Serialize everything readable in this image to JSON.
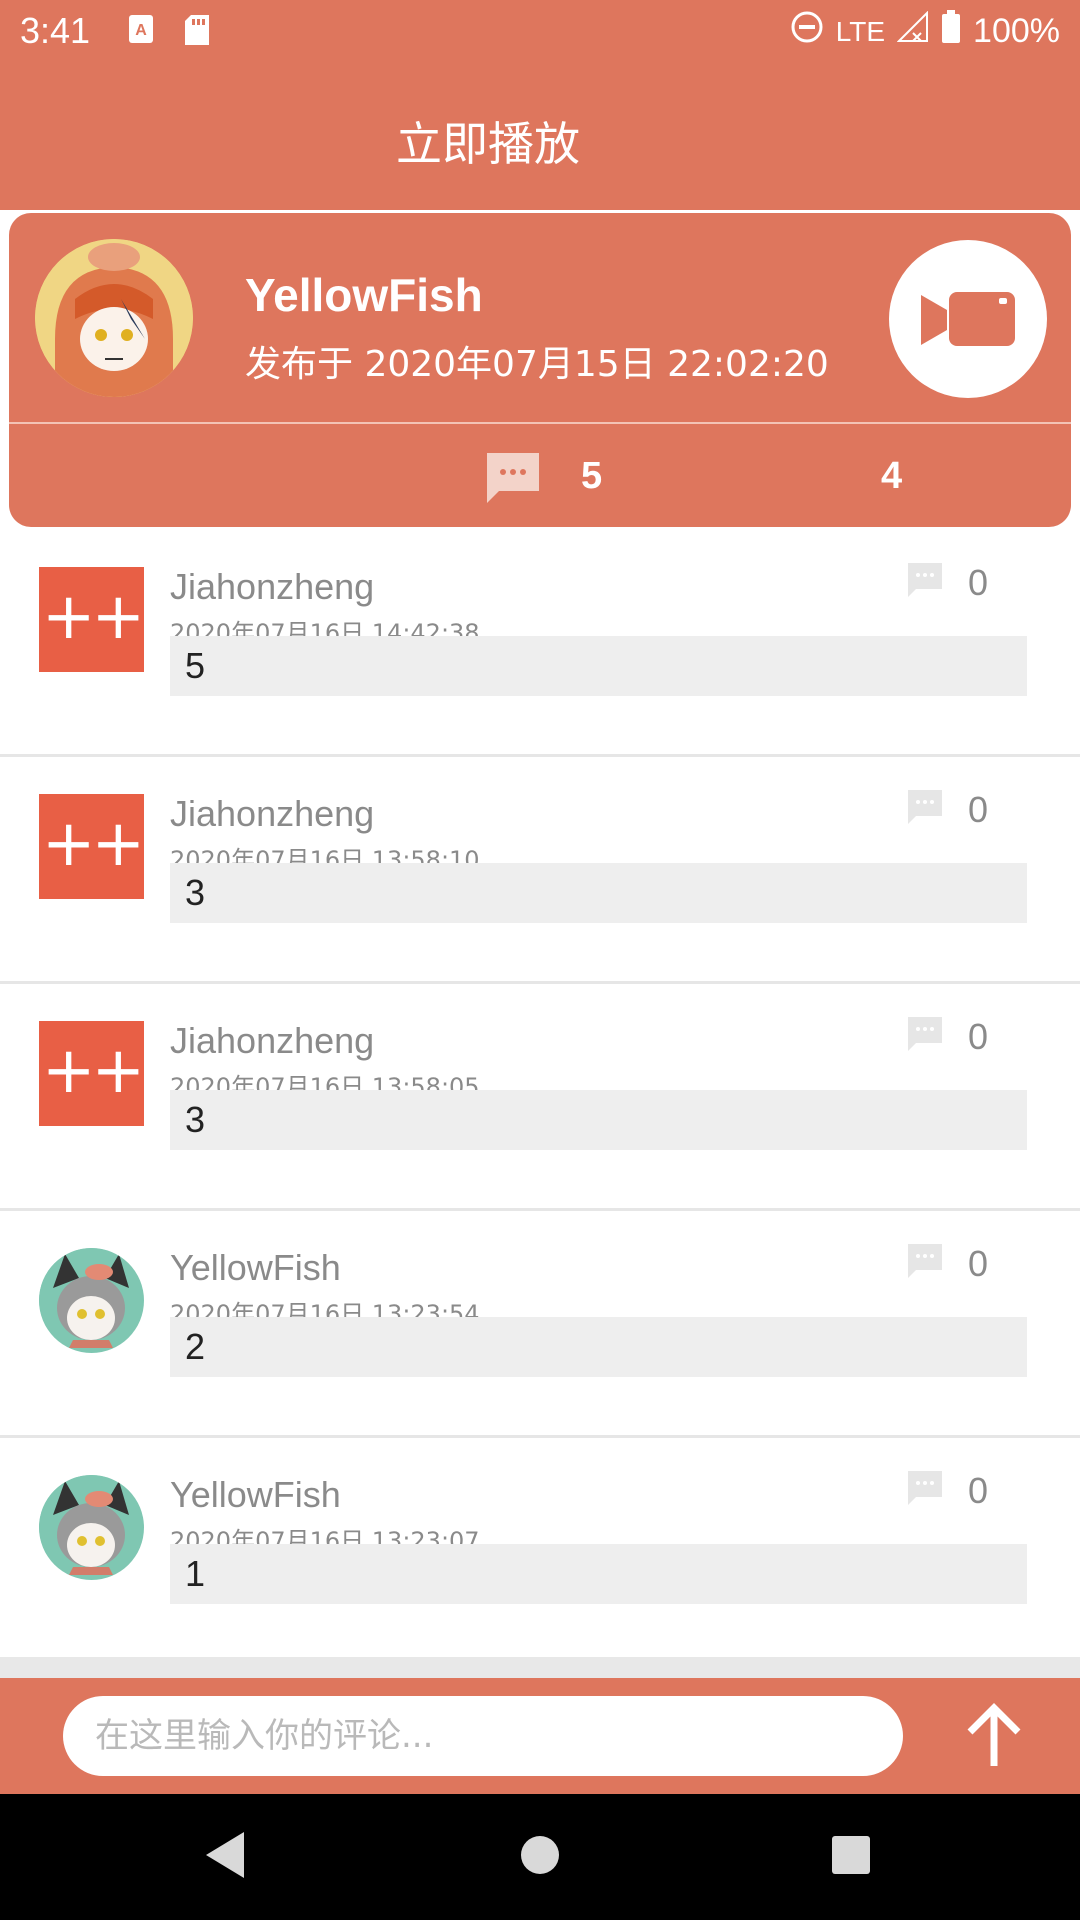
{
  "status_bar": {
    "time": "3:41",
    "battery": "100%",
    "network": "LTE"
  },
  "header": {
    "title": "立即播放"
  },
  "post": {
    "author": "YellowFish",
    "published": "发布于 2020年07月15日 22:02:20",
    "comment_count": "5",
    "like_count": "4"
  },
  "comments": [
    {
      "name": "Jiahonzheng",
      "time": "2020年07月16日 14:42:38",
      "text": "5",
      "replies": "0",
      "avatar": "cpp-logo",
      "avatar_text": "++"
    },
    {
      "name": "Jiahonzheng",
      "time": "2020年07月16日 13:58:10",
      "text": "3",
      "replies": "0",
      "avatar": "cpp-logo",
      "avatar_text": "++"
    },
    {
      "name": "Jiahonzheng",
      "time": "2020年07月16日 13:58:05",
      "text": "3",
      "replies": "0",
      "avatar": "cpp-logo",
      "avatar_text": "++"
    },
    {
      "name": "YellowFish",
      "time": "2020年07月16日 13:23:54",
      "text": "2",
      "replies": "0",
      "avatar": "anime-avatar"
    },
    {
      "name": "YellowFish",
      "time": "2020年07月16日 13:23:07",
      "text": "1",
      "replies": "0",
      "avatar": "anime-avatar"
    }
  ],
  "input": {
    "placeholder": "在这里输入你的评论..."
  },
  "colors": {
    "accent": "#de765d",
    "cpp_avatar": "#e85f45",
    "comment_bg": "#eeeeee"
  },
  "icons": {
    "video": "video-camera-icon",
    "comment": "comment-bubble-icon",
    "send": "arrow-up-icon"
  }
}
